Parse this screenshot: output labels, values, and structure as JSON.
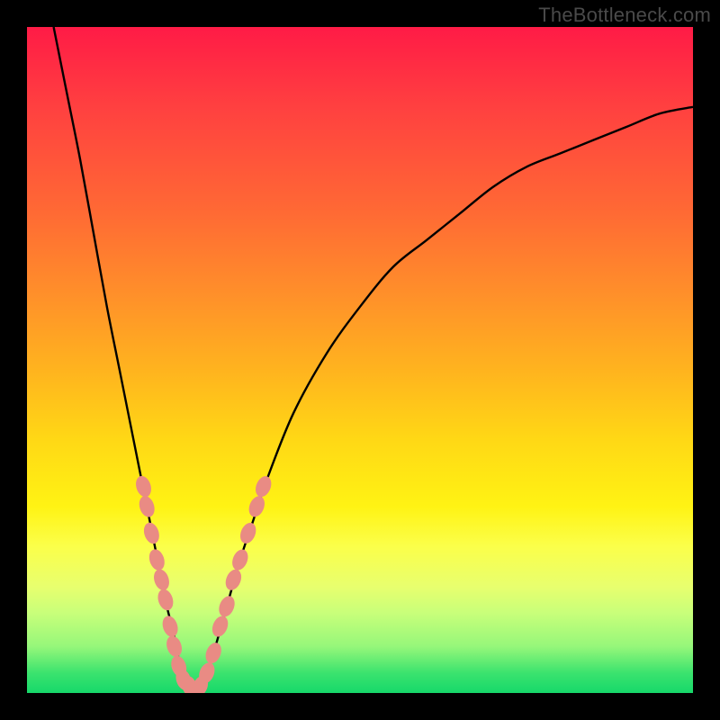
{
  "watermark": "TheBottleneck.com",
  "chart_data": {
    "type": "line",
    "title": "",
    "xlabel": "",
    "ylabel": "",
    "xlim": [
      0,
      100
    ],
    "ylim": [
      0,
      100
    ],
    "note": "Bottleneck-style V curve on a red→green vertical gradient background. Two black curves meeting near a minimum around x≈24, y≈0. Pink bead markers cluster along both branches near the valley.",
    "series": [
      {
        "name": "left-branch",
        "x": [
          4,
          6,
          8,
          10,
          12,
          14,
          16,
          18,
          19,
          20,
          21,
          22,
          23,
          24
        ],
        "y": [
          100,
          90,
          80,
          69,
          58,
          48,
          38,
          28,
          23,
          18,
          13,
          9,
          4,
          0
        ]
      },
      {
        "name": "right-branch",
        "x": [
          26,
          28,
          30,
          32,
          34,
          36,
          40,
          45,
          50,
          55,
          60,
          65,
          70,
          75,
          80,
          85,
          90,
          95,
          100
        ],
        "y": [
          0,
          6,
          13,
          20,
          26,
          32,
          42,
          51,
          58,
          64,
          68,
          72,
          76,
          79,
          81,
          83,
          85,
          87,
          88
        ]
      }
    ],
    "markers": [
      {
        "branch": "left",
        "x": 17.5,
        "y": 31
      },
      {
        "branch": "left",
        "x": 18.0,
        "y": 28
      },
      {
        "branch": "left",
        "x": 18.7,
        "y": 24
      },
      {
        "branch": "left",
        "x": 19.5,
        "y": 20
      },
      {
        "branch": "left",
        "x": 20.2,
        "y": 17
      },
      {
        "branch": "left",
        "x": 20.8,
        "y": 14
      },
      {
        "branch": "left",
        "x": 21.5,
        "y": 10
      },
      {
        "branch": "left",
        "x": 22.1,
        "y": 7
      },
      {
        "branch": "left",
        "x": 22.8,
        "y": 4
      },
      {
        "branch": "left",
        "x": 23.5,
        "y": 2
      },
      {
        "branch": "left",
        "x": 24.4,
        "y": 1
      },
      {
        "branch": "right",
        "x": 26.0,
        "y": 1
      },
      {
        "branch": "right",
        "x": 27.0,
        "y": 3
      },
      {
        "branch": "right",
        "x": 28.0,
        "y": 6
      },
      {
        "branch": "right",
        "x": 29.0,
        "y": 10
      },
      {
        "branch": "right",
        "x": 30.0,
        "y": 13
      },
      {
        "branch": "right",
        "x": 31.0,
        "y": 17
      },
      {
        "branch": "right",
        "x": 32.0,
        "y": 20
      },
      {
        "branch": "right",
        "x": 33.2,
        "y": 24
      },
      {
        "branch": "right",
        "x": 34.5,
        "y": 28
      },
      {
        "branch": "right",
        "x": 35.5,
        "y": 31
      }
    ],
    "colors": {
      "curve": "#000000",
      "marker_fill": "#e98b84",
      "marker_stroke": "#e98b84",
      "gradient_top": "#ff1b46",
      "gradient_bottom": "#16d86a"
    }
  }
}
